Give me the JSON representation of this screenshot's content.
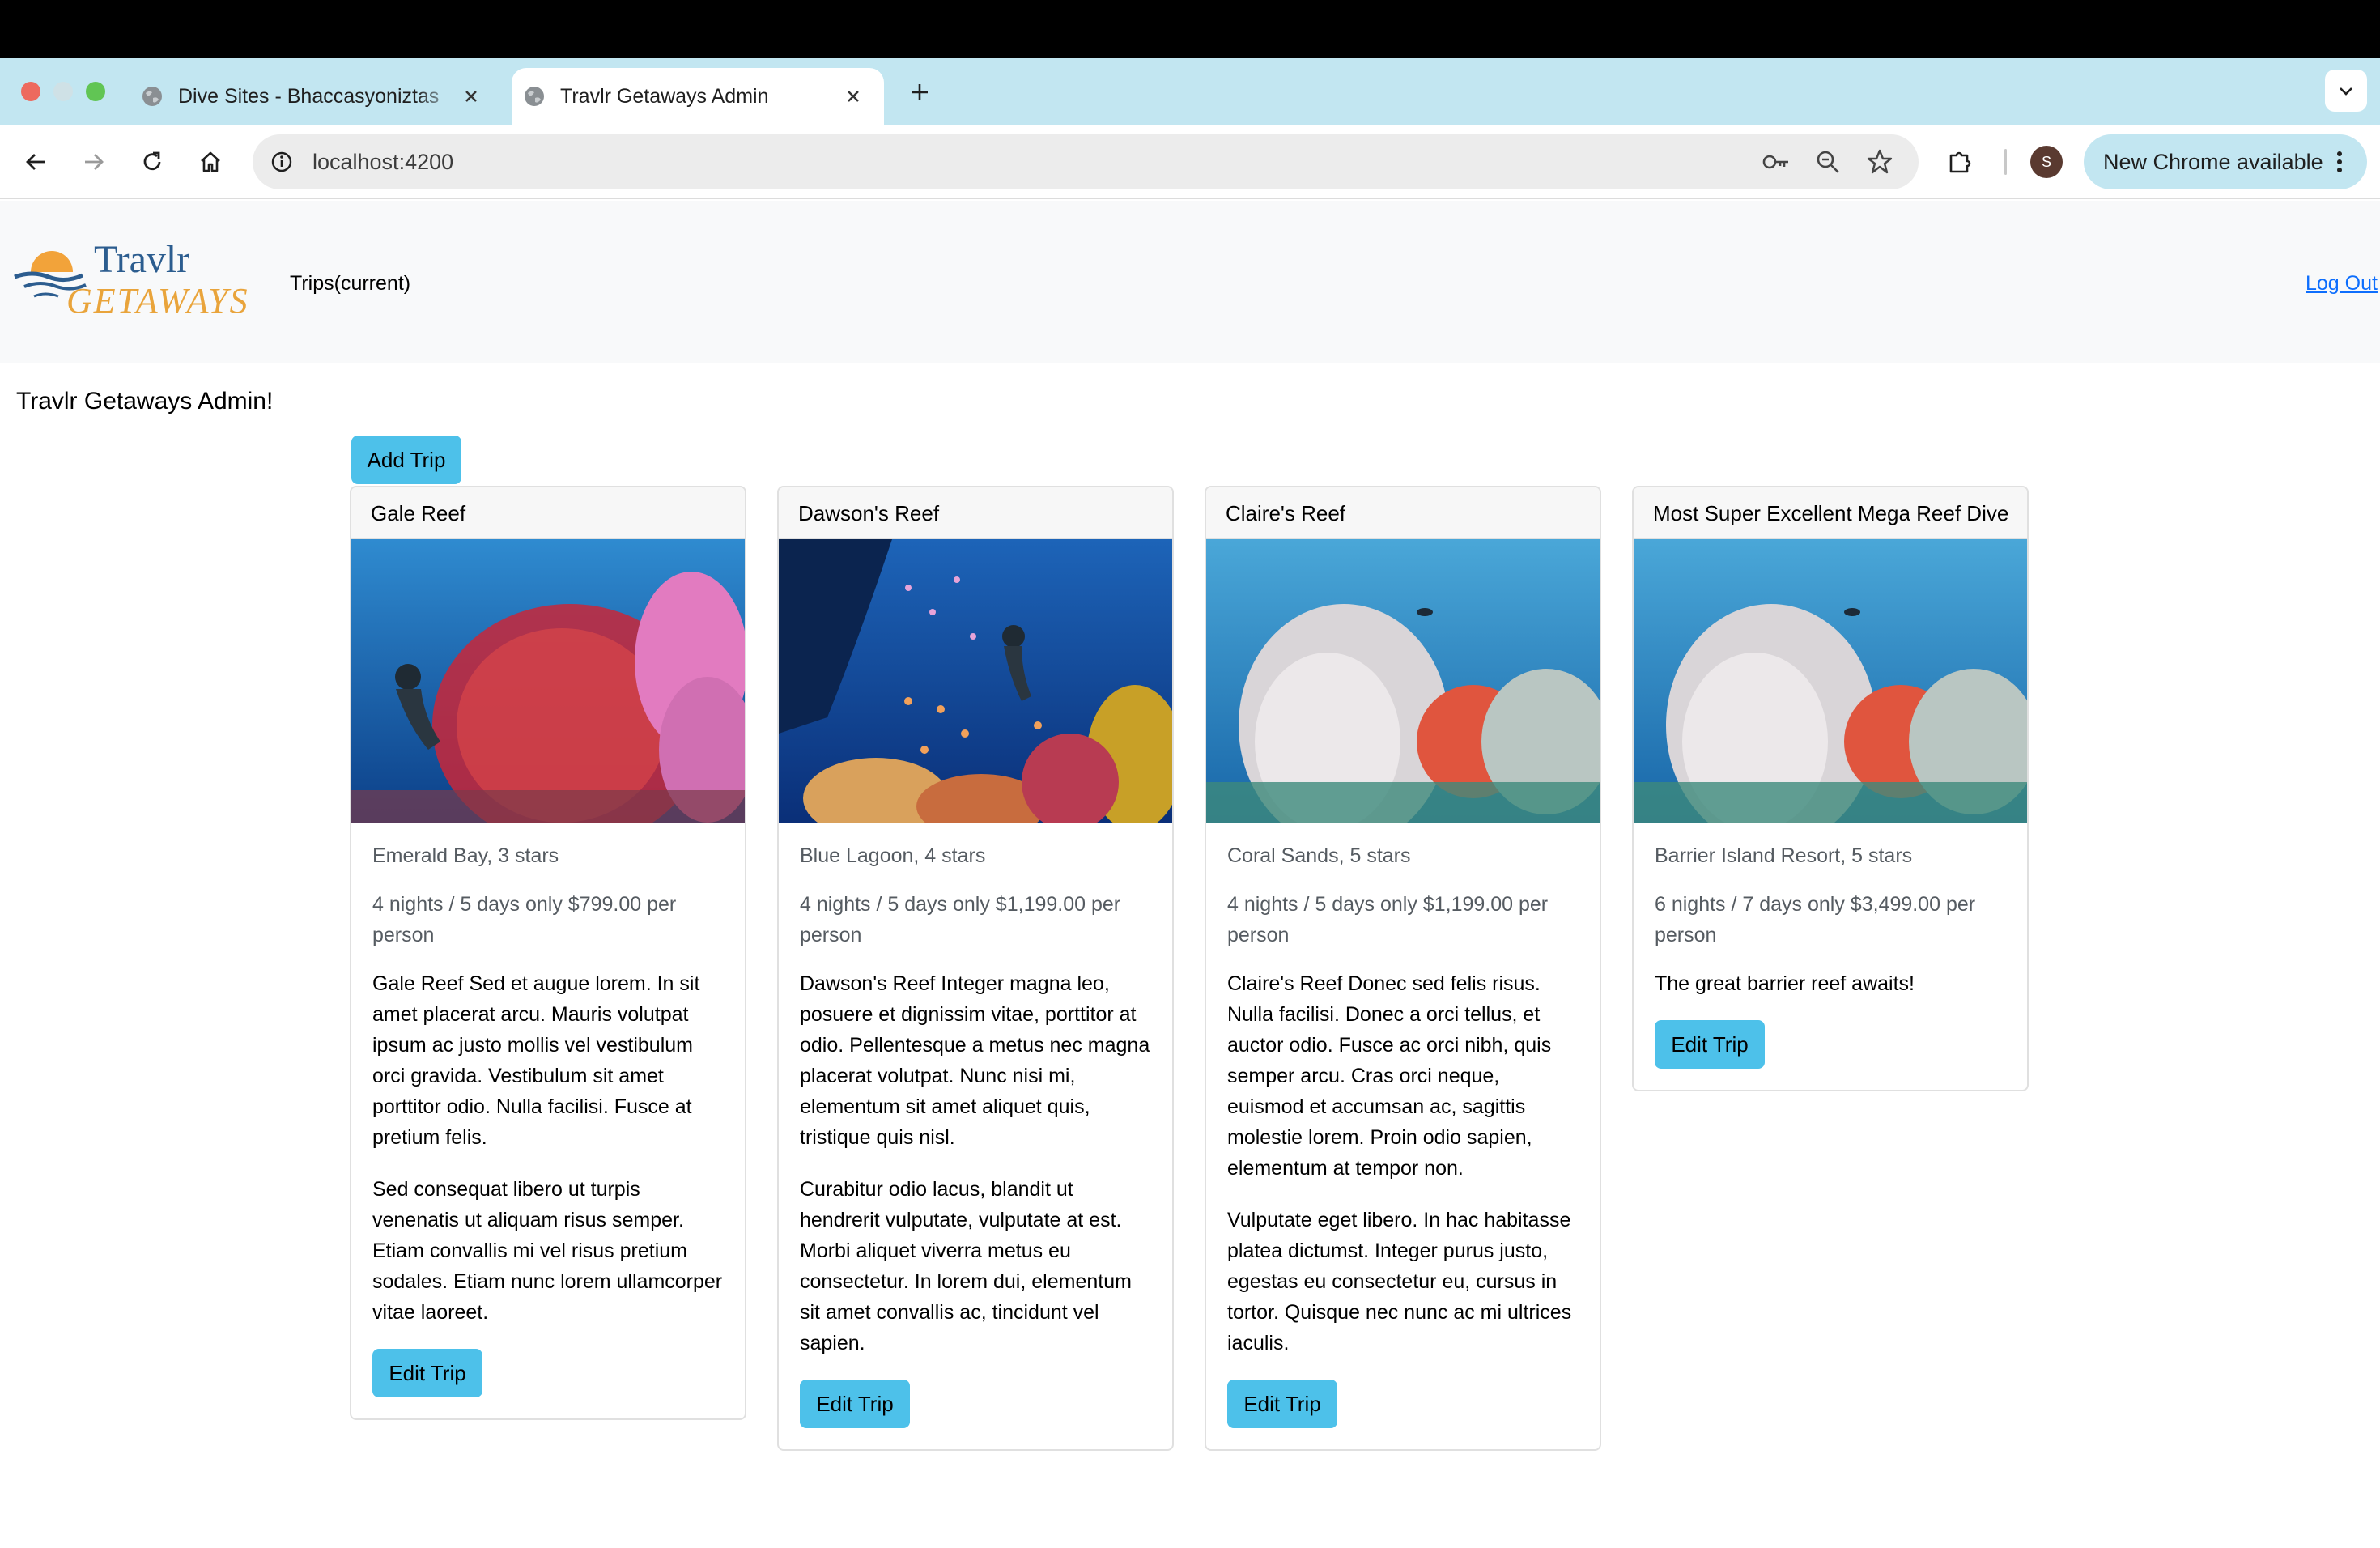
{
  "browser": {
    "tabs": [
      {
        "title": "Dive Sites - Bhaccasyoniztas",
        "active": false
      },
      {
        "title": "Travlr Getaways Admin",
        "active": true
      }
    ],
    "url": "localhost:4200",
    "update_label": "New Chrome available",
    "profile_initial": "S"
  },
  "navbar": {
    "logo_text_top": "Travlr",
    "logo_text_bottom": "GETAWAYS",
    "trips_link": "Trips(current)",
    "logout_link": "Log Out"
  },
  "main": {
    "heading": "Travlr Getaways Admin!",
    "add_trip_label": "Add Trip",
    "edit_trip_label": "Edit Trip"
  },
  "trips": [
    {
      "name": "Gale Reef",
      "resort": "Emerald Bay, 3 stars",
      "price": "4 nights / 5 days only $799.00 per person",
      "paragraphs": [
        "Gale Reef Sed et augue lorem. In sit amet placerat arcu. Mauris volutpat ipsum ac justo mollis vel vestibulum orci gravida. Vestibulum sit amet porttitor odio. Nulla facilisi. Fusce at pretium felis.",
        "Sed consequat libero ut turpis venenatis ut aliquam risus semper. Etiam convallis mi vel risus pretium sodales. Etiam nunc lorem ullamcorper vitae laoreet."
      ]
    },
    {
      "name": "Dawson's Reef",
      "resort": "Blue Lagoon, 4 stars",
      "price": "4 nights / 5 days only $1,199.00 per person",
      "paragraphs": [
        "Dawson's Reef Integer magna leo, posuere et dignissim vitae, porttitor at odio. Pellentesque a metus nec magna placerat volutpat. Nunc nisi mi, elementum sit amet aliquet quis, tristique quis nisl.",
        "Curabitur odio lacus, blandit ut hendrerit vulputate, vulputate at est. Morbi aliquet viverra metus eu consectetur. In lorem dui, elementum sit amet convallis ac, tincidunt vel sapien."
      ]
    },
    {
      "name": "Claire's Reef",
      "resort": "Coral Sands, 5 stars",
      "price": "4 nights / 5 days only $1,199.00 per person",
      "paragraphs": [
        "Claire's Reef Donec sed felis risus. Nulla facilisi. Donec a orci tellus, et auctor odio. Fusce ac orci nibh, quis semper arcu. Cras orci neque, euismod et accumsan ac, sagittis molestie lorem. Proin odio sapien, elementum at tempor non.",
        "Vulputate eget libero. In hac habitasse platea dictumst. Integer purus justo, egestas eu consectetur eu, cursus in tortor. Quisque nec nunc ac mi ultrices iaculis."
      ]
    },
    {
      "name": "Most Super Excellent Mega Reef Dive",
      "resort": "Barrier Island Resort, 5 stars",
      "price": "6 nights / 7 days only $3,499.00 per person",
      "paragraphs": [
        "The great barrier reef awaits!"
      ]
    }
  ],
  "colors": {
    "tabstrip": "#c2e6f1",
    "navbar_bg": "#f8f9fa",
    "btn_info": "#4dc1ea",
    "link": "#0d6efd"
  }
}
